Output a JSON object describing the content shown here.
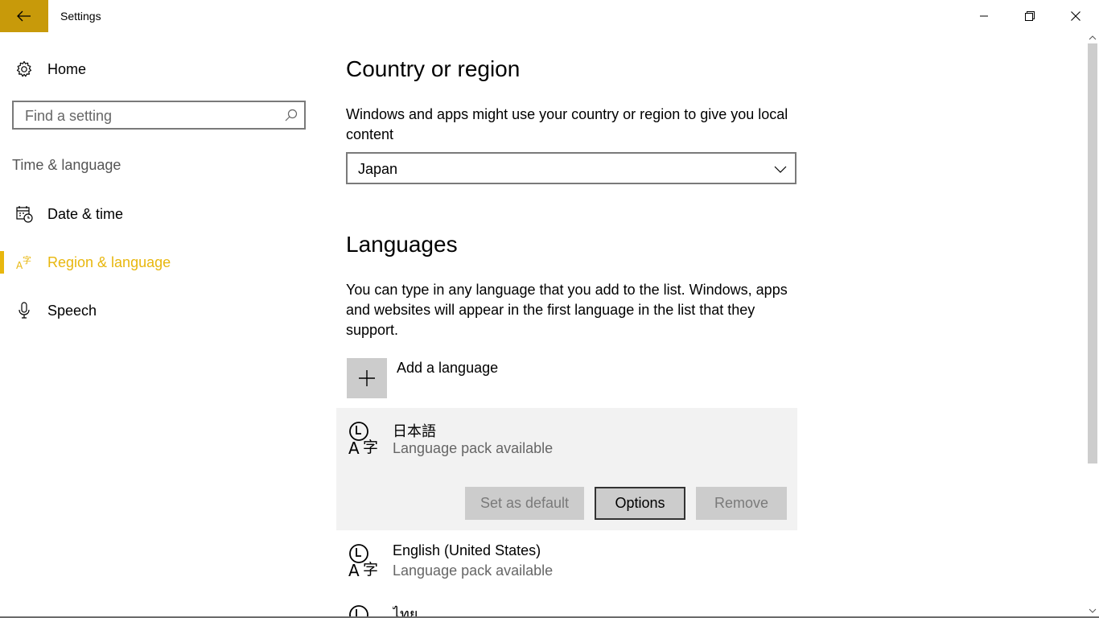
{
  "window": {
    "title": "Settings"
  },
  "sidebar": {
    "home_label": "Home",
    "search_placeholder": "Find a setting",
    "section_title": "Time & language",
    "items": [
      {
        "label": "Date & time",
        "icon": "calendar-clock-icon"
      },
      {
        "label": "Region & language",
        "icon": "language-icon",
        "selected": true
      },
      {
        "label": "Speech",
        "icon": "microphone-icon"
      }
    ]
  },
  "country": {
    "heading": "Country or region",
    "description": "Windows and apps might use your country or region to give you local content",
    "selected": "Japan"
  },
  "languages": {
    "heading": "Languages",
    "description": "You can type in any language that you add to the list. Windows, apps and websites will appear in the first language in the list that they support.",
    "add_label": "Add a language",
    "list": [
      {
        "name": "日本語",
        "status": "Language pack available"
      },
      {
        "name": "English (United States)",
        "status": "Language pack available"
      },
      {
        "name": "ไทย"
      }
    ],
    "buttons": {
      "set_default": "Set as default",
      "options": "Options",
      "remove": "Remove"
    }
  },
  "colors": {
    "accent": "#c89a0a",
    "selected_text": "#e8b70e",
    "panel_bg": "#f2f2f2"
  }
}
